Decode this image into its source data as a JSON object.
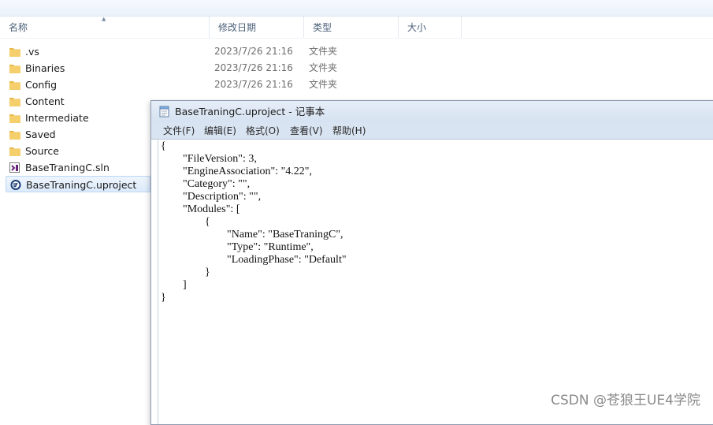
{
  "explorer": {
    "columns": {
      "name": "名称",
      "modified": "修改日期",
      "type": "类型",
      "size": "大小"
    },
    "files": [
      {
        "name": ".vs",
        "modified": "2023/7/26 21:16",
        "type": "文件夹",
        "icon": "folder-icon"
      },
      {
        "name": "Binaries",
        "modified": "2023/7/26 21:16",
        "type": "文件夹",
        "icon": "folder-icon"
      },
      {
        "name": "Config",
        "modified": "2023/7/26 21:16",
        "type": "文件夹",
        "icon": "folder-icon"
      },
      {
        "name": "Content",
        "modified": "",
        "type": "",
        "icon": "folder-icon"
      },
      {
        "name": "Intermediate",
        "modified": "",
        "type": "",
        "icon": "folder-icon"
      },
      {
        "name": "Saved",
        "modified": "",
        "type": "",
        "icon": "folder-icon"
      },
      {
        "name": "Source",
        "modified": "",
        "type": "",
        "icon": "folder-icon"
      },
      {
        "name": "BaseTraningC.sln",
        "modified": "",
        "type": "",
        "icon": "visual-studio-solution-icon"
      },
      {
        "name": "BaseTraningC.uproject",
        "modified": "",
        "type": "",
        "icon": "unreal-engine-icon",
        "selected": true
      }
    ]
  },
  "notepad": {
    "title": "BaseTraningC.uproject - 记事本",
    "menu": [
      "文件(F)",
      "编辑(E)",
      "格式(O)",
      "查看(V)",
      "帮助(H)"
    ],
    "content": "{\n\t\"FileVersion\": 3,\n\t\"EngineAssociation\": \"4.22\",\n\t\"Category\": \"\",\n\t\"Description\": \"\",\n\t\"Modules\": [\n\t\t{\n\t\t\t\"Name\": \"BaseTraningC\",\n\t\t\t\"Type\": \"Runtime\",\n\t\t\t\"LoadingPhase\": \"Default\"\n\t\t}\n\t]\n}"
  },
  "watermark": "CSDN @苍狼王UE4学院",
  "colors": {
    "folder": "#e8b94a",
    "selection": "#dceafb",
    "header_text": "#4c607a"
  }
}
